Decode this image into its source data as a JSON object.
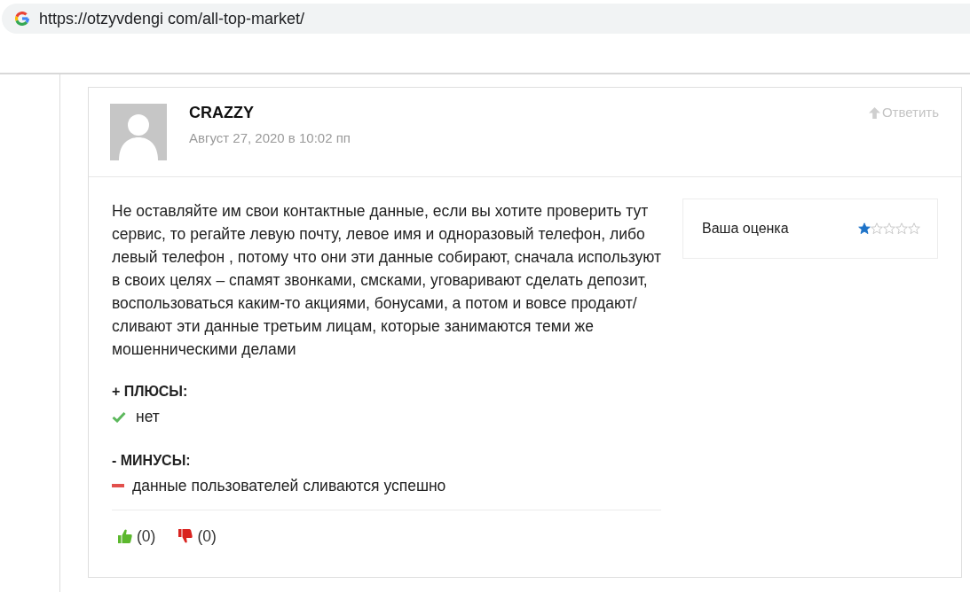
{
  "browser": {
    "url": "https://otzyvdengi com/all-top-market/"
  },
  "comment": {
    "author": "CRAZZY",
    "date": "Август 27, 2020 в 10:02 пп",
    "reply_link": "Ответить",
    "text": "Не оставляйте им свои контактные данные, если вы хотите проверить тут сервис, то регайте левую почту, левое имя и одноразовый телефон, либо левый телефон , потому что они эти данные собирают, сначала используют в своих целях – спамят звонками, смсками, уговаривают сделать депозит, воспользоваться каким-то акциями, бонусами, а потом и вовсе продают/ сливают эти данные третьим лицам, которые занимаются теми же мошенническими делами",
    "rating": {
      "label": "Ваша оценка",
      "stars": 1
    },
    "pros": {
      "heading": "+ ПЛЮСЫ:",
      "items": [
        "нет"
      ]
    },
    "cons": {
      "heading": "- МИНУСЫ:",
      "items": [
        "данные пользователей сливаются успешно"
      ]
    },
    "votes": [
      {
        "kind": "up",
        "count": "(0)"
      },
      {
        "kind": "down",
        "count": "(0)"
      }
    ]
  }
}
